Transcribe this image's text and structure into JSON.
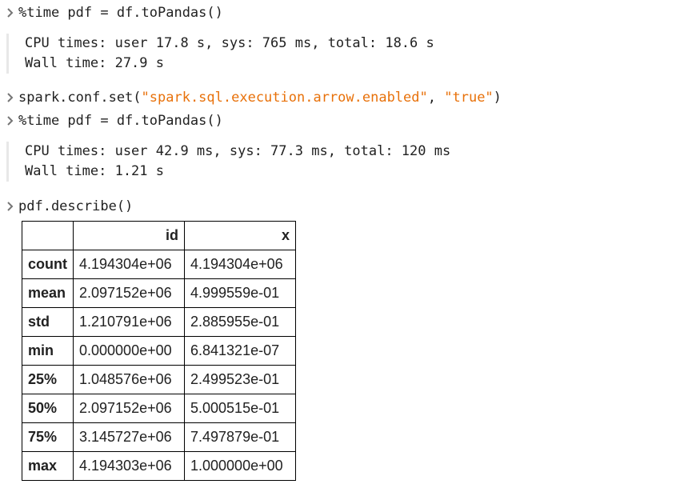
{
  "cells": [
    {
      "input": {
        "pre": "%time pdf = df.toPandas()"
      },
      "output": [
        "CPU times: user 17.8 s, sys: 765 ms, total: 18.6 s",
        "Wall time: 27.9 s"
      ]
    },
    {
      "input": {
        "pre": "spark.conf.set(",
        "str1": "\"spark.sql.execution.arrow.enabled\"",
        "mid": ", ",
        "str2": "\"true\"",
        "post": ")"
      }
    },
    {
      "input": {
        "pre": "%time pdf = df.toPandas()"
      },
      "output": [
        "CPU times: user 42.9 ms, sys: 77.3 ms, total: 120 ms",
        "Wall time: 1.21 s"
      ]
    },
    {
      "input": {
        "pre": "pdf.describe()"
      }
    }
  ],
  "table": {
    "columns": [
      "",
      "id",
      "x"
    ],
    "rows": [
      {
        "label": "count",
        "id": "4.194304e+06",
        "x": "4.194304e+06"
      },
      {
        "label": "mean",
        "id": "2.097152e+06",
        "x": "4.999559e-01"
      },
      {
        "label": "std",
        "id": "1.210791e+06",
        "x": "2.885955e-01"
      },
      {
        "label": "min",
        "id": "0.000000e+00",
        "x": "6.841321e-07"
      },
      {
        "label": "25%",
        "id": "1.048576e+06",
        "x": "2.499523e-01"
      },
      {
        "label": "50%",
        "id": "2.097152e+06",
        "x": "5.000515e-01"
      },
      {
        "label": "75%",
        "id": "3.145727e+06",
        "x": "7.497879e-01"
      },
      {
        "label": "max",
        "id": "4.194303e+06",
        "x": "1.000000e+00"
      }
    ]
  },
  "colors": {
    "string": "#e8710a",
    "output_bar": "#e8e8e8",
    "chevron": "#757575"
  }
}
